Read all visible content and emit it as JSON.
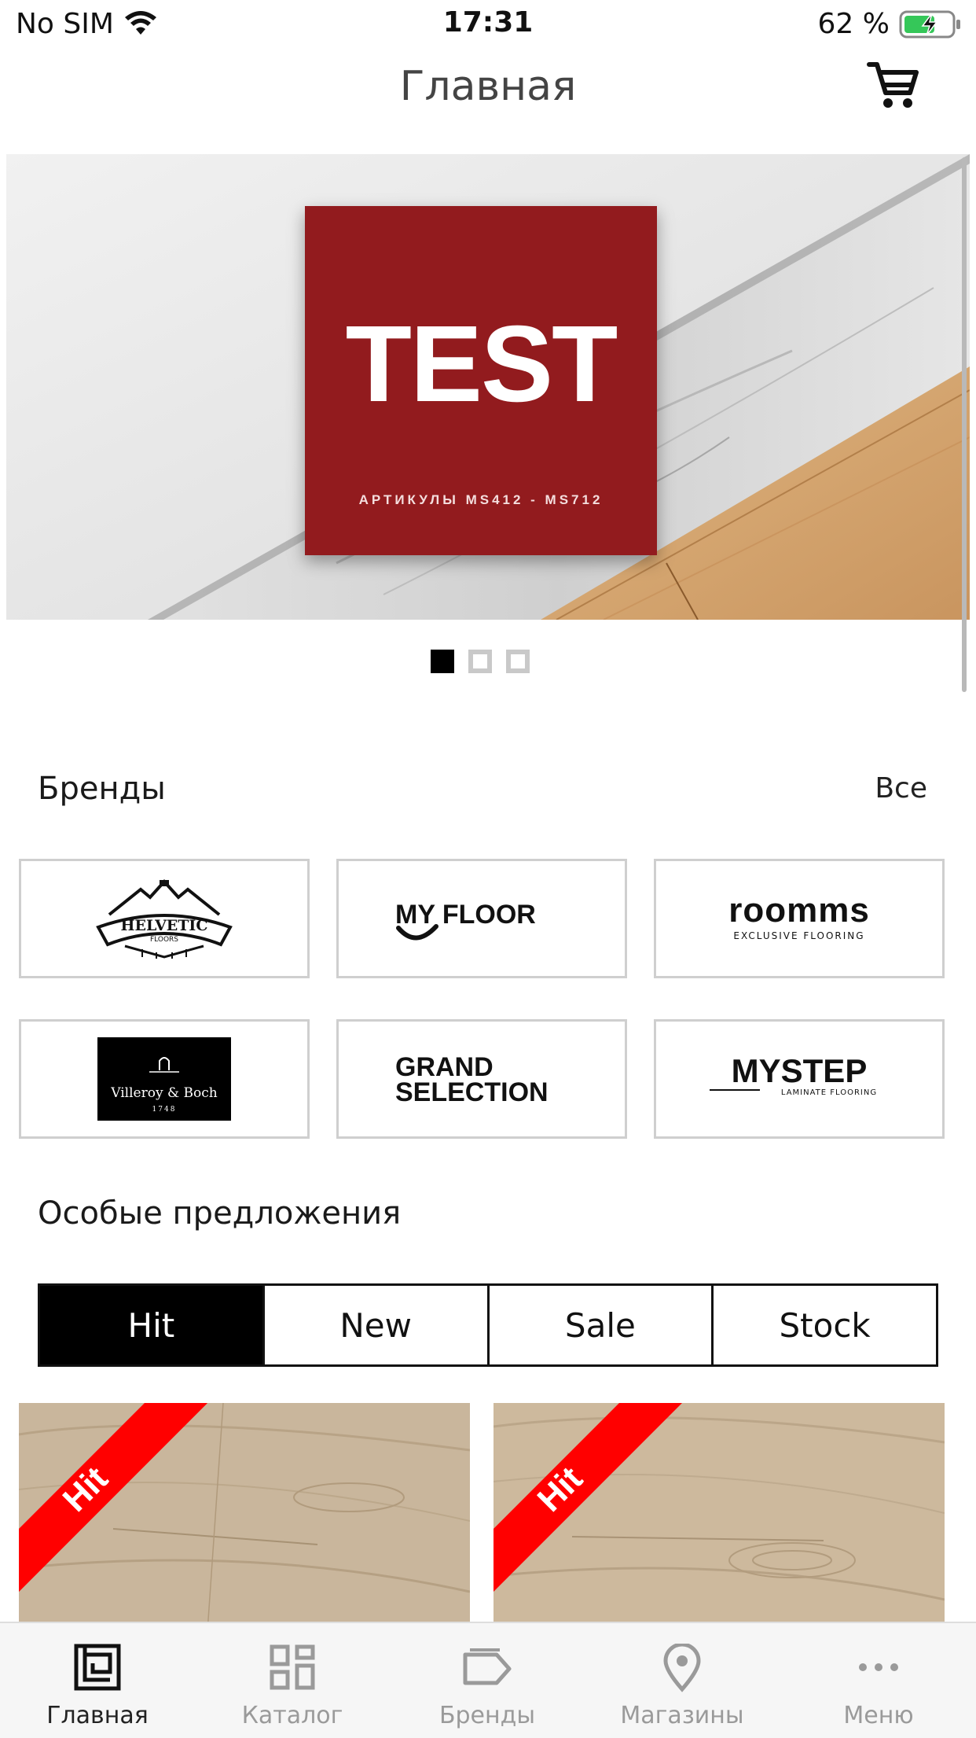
{
  "status_bar": {
    "carrier": "No SIM",
    "time": "17:31",
    "battery": "62 %"
  },
  "header": {
    "title": "Главная",
    "cart_icon": "cart-icon"
  },
  "banner": {
    "headline": "TEST",
    "subtitle": "АРТИКУЛЫ MS412 - MS712",
    "slides": 3,
    "active_slide": 1,
    "brand_color": "#921b1e"
  },
  "brands": {
    "title": "Бренды",
    "see_all": "Все",
    "items": [
      {
        "name": "HELVETIC",
        "sub": "FLOORS"
      },
      {
        "name": "MY FLOOR",
        "sub": ""
      },
      {
        "name": "roomms",
        "sub": "EXCLUSIVE FLOORING"
      },
      {
        "name": "Villeroy & Boch",
        "sub": "1748"
      },
      {
        "name": "GRAND",
        "sub": "SELECTION"
      },
      {
        "name": "MYSTEP",
        "sub": "LAMINATE FLOORING"
      }
    ]
  },
  "offers": {
    "title": "Особые предложения",
    "tabs": [
      "Hit",
      "New",
      "Sale",
      "Stock"
    ],
    "active_tab": "Hit",
    "products": [
      {
        "badge": "Hit"
      },
      {
        "badge": "Hit"
      }
    ],
    "badge_color": "#ff0000"
  },
  "tabbar": {
    "items": [
      {
        "label": "Главная",
        "icon": "home-icon",
        "active": true
      },
      {
        "label": "Каталог",
        "icon": "catalog-icon",
        "active": false
      },
      {
        "label": "Бренды",
        "icon": "brands-tag-icon",
        "active": false
      },
      {
        "label": "Магазины",
        "icon": "location-pin-icon",
        "active": false
      },
      {
        "label": "Меню",
        "icon": "more-dots-icon",
        "active": false
      }
    ]
  }
}
